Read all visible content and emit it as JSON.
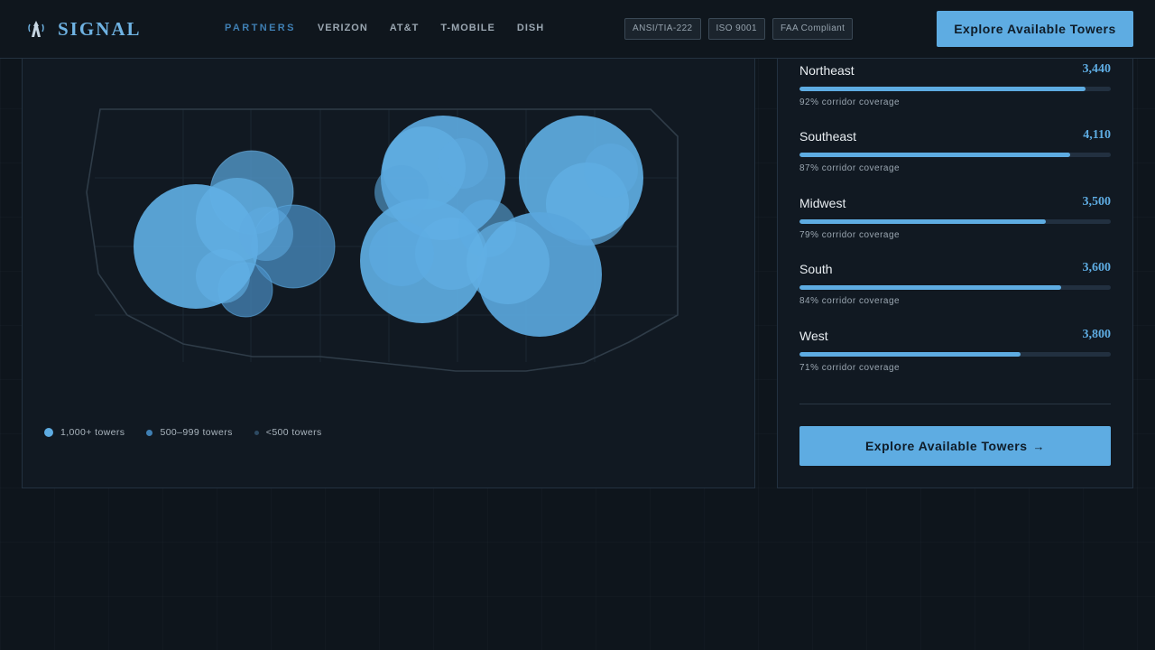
{
  "brand": {
    "name": "SIGNAL",
    "icon": "tower-icon"
  },
  "nav": {
    "items": [
      {
        "label": "PARTNERS",
        "active": true
      },
      {
        "label": "VERIZON",
        "active": false
      },
      {
        "label": "AT&T",
        "active": false
      },
      {
        "label": "T-MOBILE",
        "active": false
      },
      {
        "label": "DISH",
        "active": false
      }
    ]
  },
  "badges": [
    "ANSI/TIA-222",
    "ISO 9001",
    "FAA Compliant"
  ],
  "header_cta": {
    "label": "Explore Available Towers"
  },
  "map": {
    "legend": [
      {
        "label": "1,000+ towers",
        "color": "#5eace2"
      },
      {
        "label": "500–999 towers",
        "color": "#3f7fb3"
      },
      {
        "label": "<500 towers",
        "color": "#2d4a63"
      }
    ]
  },
  "regions": [
    {
      "name": "Northeast",
      "count": "3,440",
      "coverage_pct": 92,
      "coverage_label": "92% corridor coverage"
    },
    {
      "name": "Southeast",
      "count": "4,110",
      "coverage_pct": 87,
      "coverage_label": "87% corridor coverage"
    },
    {
      "name": "Midwest",
      "count": "3,500",
      "coverage_pct": 79,
      "coverage_label": "79% corridor coverage"
    },
    {
      "name": "South",
      "count": "3,600",
      "coverage_pct": 84,
      "coverage_label": "84% corridor coverage"
    },
    {
      "name": "West",
      "count": "3,800",
      "coverage_pct": 71,
      "coverage_label": "71% corridor coverage"
    }
  ],
  "panel_cta": {
    "label": "Explore Available Towers",
    "arrow": "→"
  },
  "colors": {
    "accent": "#5eace2",
    "accent_dark": "#3f7fb3",
    "background": "#0e151c"
  }
}
